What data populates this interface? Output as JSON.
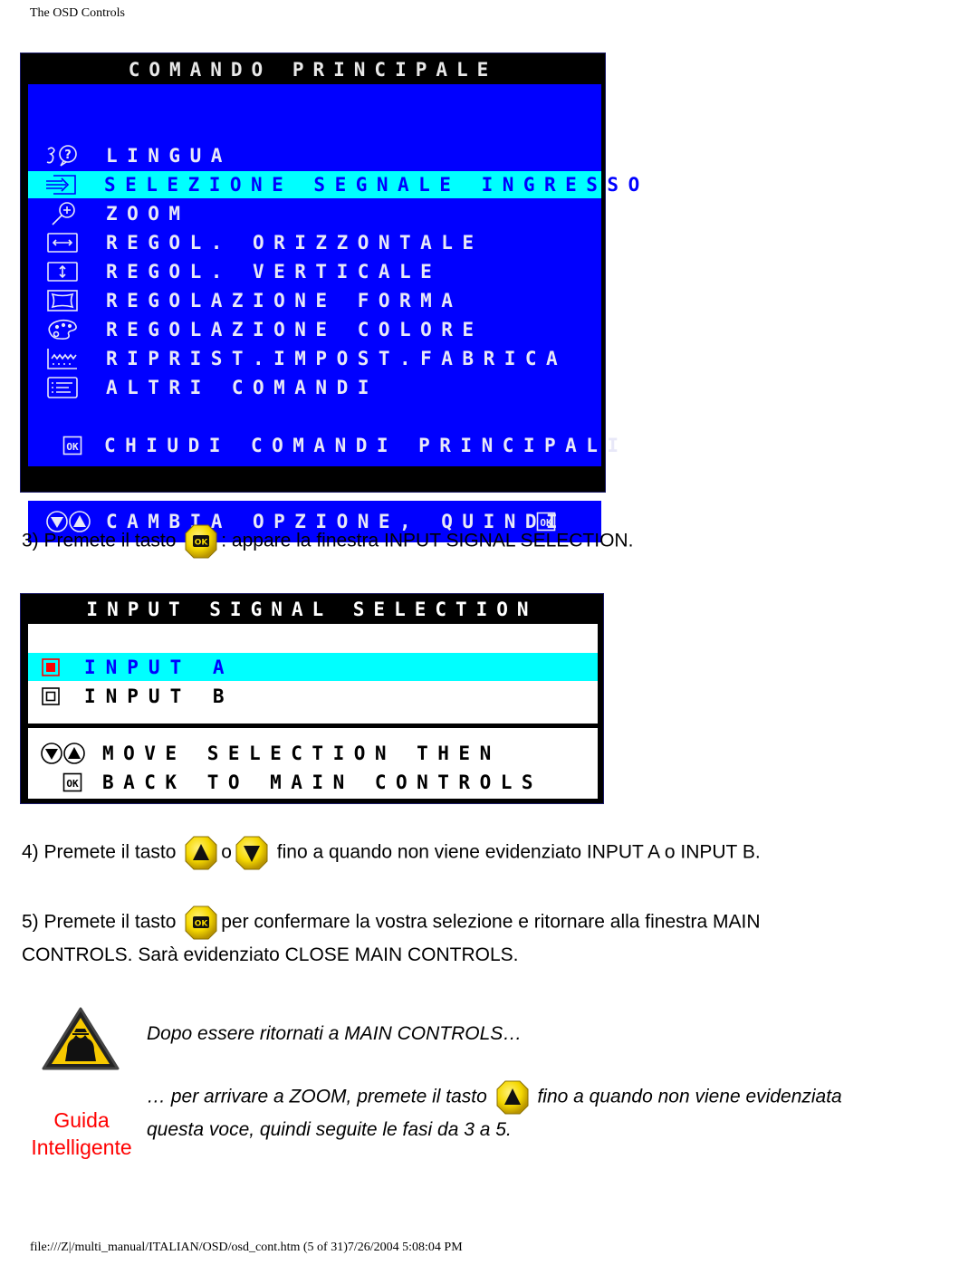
{
  "page": {
    "header": "The OSD Controls",
    "footer": "file:///Z|/multi_manual/ITALIAN/OSD/osd_cont.htm (5 of 31)7/26/2004 5:08:04 PM"
  },
  "main_controls": {
    "title": "COMANDO PRINCIPALE",
    "items": [
      {
        "icon": "language-icon",
        "label": "LINGUA",
        "selected": false
      },
      {
        "icon": "input-signal-icon",
        "label": "SELEZIONE SEGNALE INGRESSO",
        "selected": true
      },
      {
        "icon": "zoom-icon",
        "label": "ZOOM",
        "selected": false
      },
      {
        "icon": "horizontal-adjust-icon",
        "label": "REGOL. ORIZZONTALE",
        "selected": false
      },
      {
        "icon": "vertical-adjust-icon",
        "label": "REGOL. VERTICALE",
        "selected": false
      },
      {
        "icon": "shape-adjust-icon",
        "label": "REGOLAZIONE FORMA",
        "selected": false
      },
      {
        "icon": "color-palette-icon",
        "label": "REGOLAZIONE COLORE",
        "selected": false
      },
      {
        "icon": "factory-reset-icon",
        "label": "RIPRIST.IMPOST.FABRICA",
        "selected": false
      },
      {
        "icon": "other-controls-icon",
        "label": "ALTRI COMANDI",
        "selected": false
      }
    ],
    "close_label": "CHIUDI COMANDI PRINCIPALI",
    "footer_label": "CAMBIA OPZIONE, QUINDI"
  },
  "step3": {
    "prefix": "3) Premete il tasto",
    "suffix": ": appare la finestra INPUT SIGNAL SELECTION."
  },
  "input_selection": {
    "title": "INPUT SIGNAL SELECTION",
    "options": [
      {
        "label": "INPUT A",
        "selected": true
      },
      {
        "label": "INPUT B",
        "selected": false
      }
    ],
    "hint_move": "MOVE SELECTION THEN",
    "hint_back": "BACK TO MAIN CONTROLS"
  },
  "step4": {
    "prefix": "4) Premete il tasto",
    "or": "o",
    "suffix": "fino a quando non viene evidenziato INPUT A o INPUT B."
  },
  "step5": {
    "prefix": "5) Premete il tasto",
    "suffix": "per confermare la vostra selezione e ritornare alla finestra MAIN",
    "line2": "CONTROLS. Sarà evidenziato CLOSE MAIN CONTROLS."
  },
  "smart_help": {
    "label_line1": "Guida",
    "label_line2": "Intelligente",
    "intro": "Dopo essere ritornati a MAIN CONTROLS…",
    "line1_prefix": "… per arrivare a ZOOM, premete il tasto",
    "line1_suffix": "fino a quando non viene evidenziata",
    "line2": "questa voce, quindi seguite le fasi da 3 a 5."
  },
  "colors": {
    "osd_blue": "#0000ff",
    "osd_highlight": "#00ffff",
    "osd_frame": "#000000",
    "key_yellow": "#f5d800",
    "guida_red": "#ff0000"
  }
}
